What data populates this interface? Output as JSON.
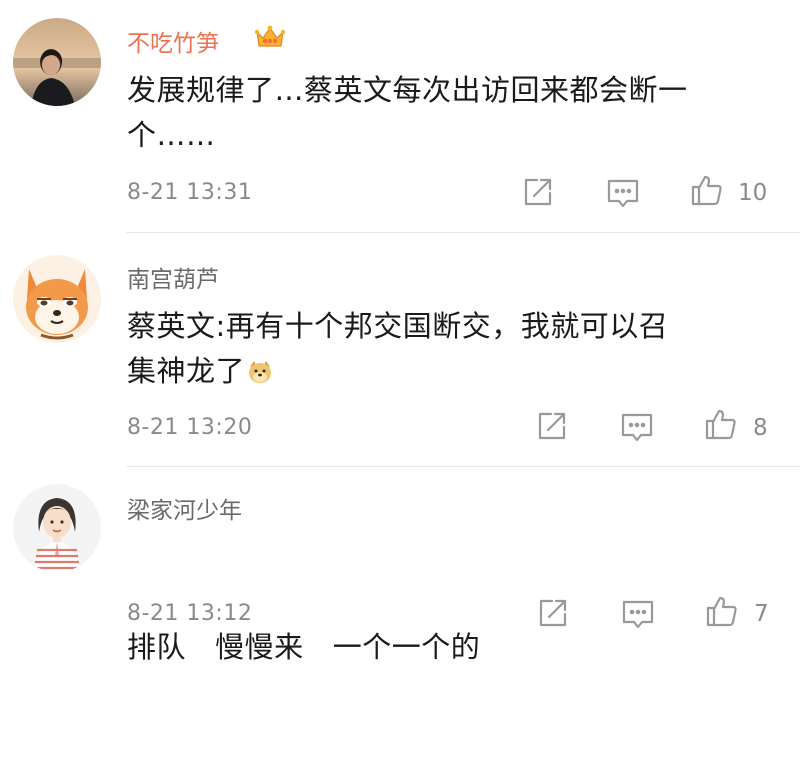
{
  "comments": [
    {
      "username": "不吃竹笋",
      "text_line1": "发展规律了…蔡英文每次出访回来都会断一",
      "text_line2": "个……",
      "time": "8-21 13:31",
      "likes": "10",
      "vip": true
    },
    {
      "username": "南宫葫芦",
      "text_line1": "蔡英文:再有十个邦交国断交，我就可以召",
      "text_line2": "集神龙了",
      "time": "8-21 13:20",
      "likes": "8",
      "vip": false
    },
    {
      "username": "梁家河少年",
      "text_line1": "排队   慢慢来   一个一个的",
      "time": "8-21 13:12",
      "likes": "7",
      "vip": false
    }
  ],
  "colors": {
    "vip_name": "#eb7350",
    "name": "#6a6a6a",
    "meta": "#8a8a8a",
    "icon": "#999999"
  },
  "icons": [
    "crown-icon",
    "repost-icon",
    "comment-icon",
    "like-icon",
    "doge-emoji-icon"
  ]
}
